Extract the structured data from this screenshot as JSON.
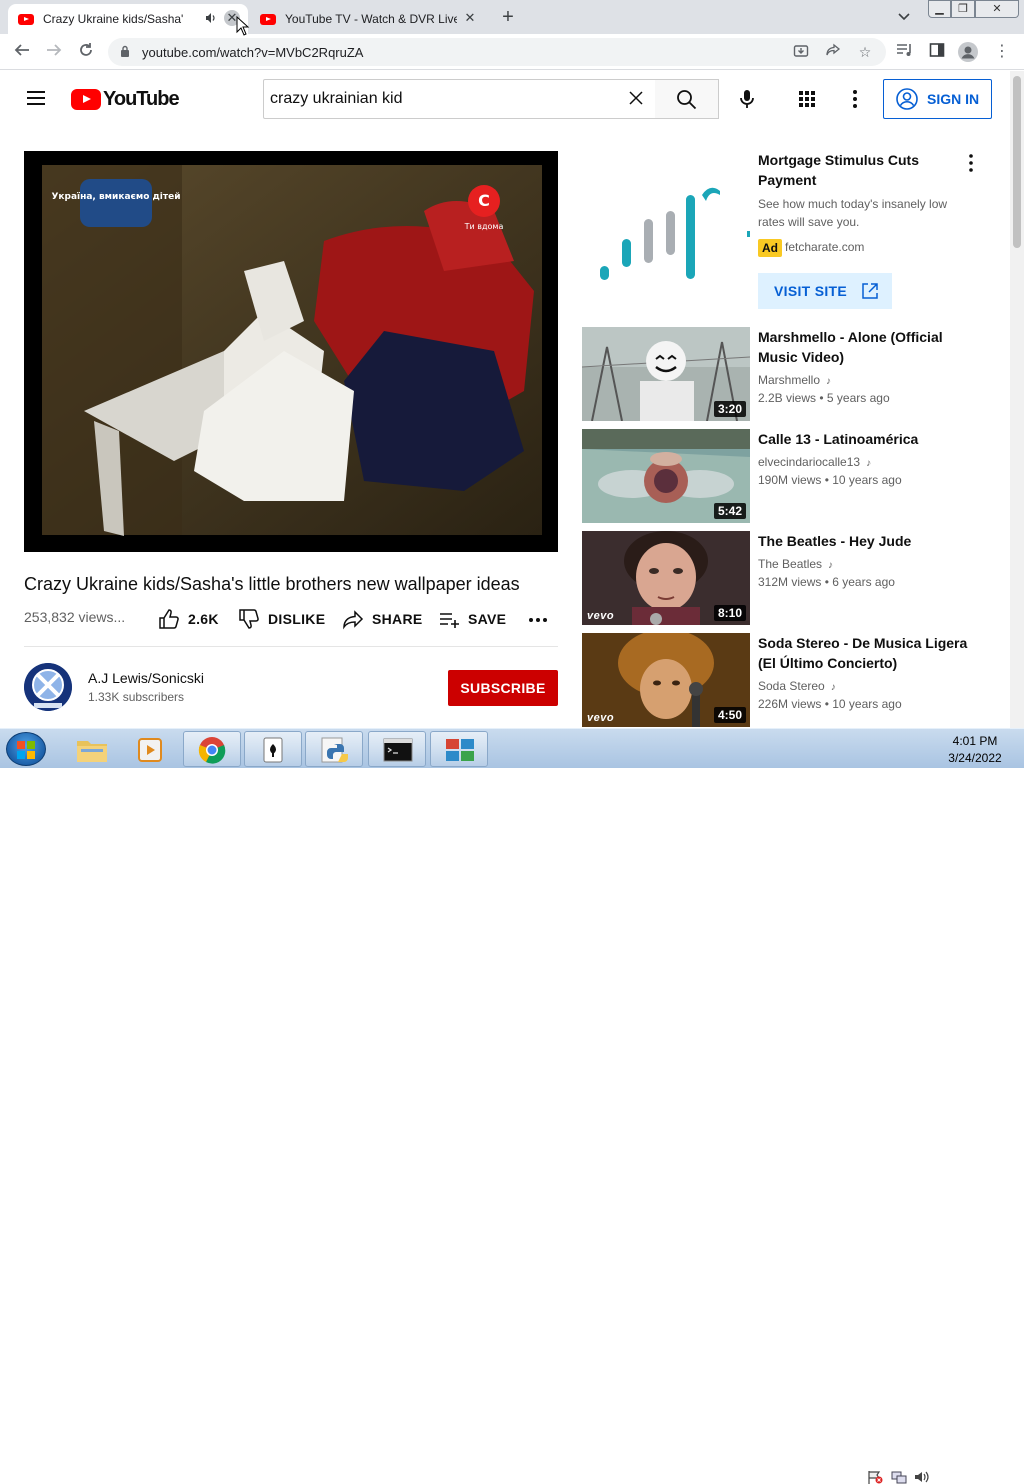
{
  "browser": {
    "tabs": [
      {
        "title": "Crazy Ukraine kids/Sasha's li",
        "active": true
      },
      {
        "title": "YouTube TV - Watch & DVR Live",
        "active": false
      }
    ],
    "url": "youtube.com/watch?v=MVbC2RqruZA"
  },
  "youtube": {
    "logo_text": "YouTube",
    "search_query": "crazy ukrainian kid",
    "sign_in_label": "SIGN IN"
  },
  "video": {
    "title": "Crazy Ukraine kids/Sasha's little brothers new wallpaper ideas",
    "views": "253,832 views...",
    "likes": "2.6K",
    "dislike_label": "DISLIKE",
    "share_label": "SHARE",
    "save_label": "SAVE",
    "overlay_left": "Україна, вмикаємо дітей",
    "overlay_right": "Ти вдома",
    "channel_name": "A.J Lewis/Sonicski",
    "subscribers": "1.33K subscribers",
    "subscribe_label": "SUBSCRIBE"
  },
  "ad": {
    "title": "Mortgage Stimulus Cuts Payment",
    "description": "See how much today's insanely low rates will save you.",
    "badge": "Ad",
    "domain": "fetcharate.com",
    "cta": "VISIT SITE"
  },
  "recommendations": [
    {
      "title": "Marshmello - Alone (Official Music Video)",
      "channel": "Marshmello",
      "views": "2.2B views",
      "age": "5 years ago",
      "duration": "3:20",
      "vevo": false
    },
    {
      "title": "Calle 13 - Latinoamérica",
      "channel": "elvecindariocalle13",
      "views": "190M views",
      "age": "10 years ago",
      "duration": "5:42",
      "vevo": false
    },
    {
      "title": "The Beatles - Hey Jude",
      "channel": "The Beatles",
      "views": "312M views",
      "age": "6 years ago",
      "duration": "8:10",
      "vevo": true
    },
    {
      "title": "Soda Stereo - De Musica Ligera (El Último Concierto)",
      "channel": "Soda Stereo",
      "views": "226M views",
      "age": "10 years ago",
      "duration": "4:50",
      "vevo": true
    }
  ],
  "meta_separator": "•",
  "vevo_text": "vevo",
  "taskbar": {
    "time": "4:01 PM",
    "date": "3/24/2022",
    "pinned": [
      "explorer-icon",
      "media-player-icon",
      "chrome-icon",
      "solitaire-icon",
      "python-icon",
      "cmd-icon",
      "app-grid-icon"
    ]
  }
}
